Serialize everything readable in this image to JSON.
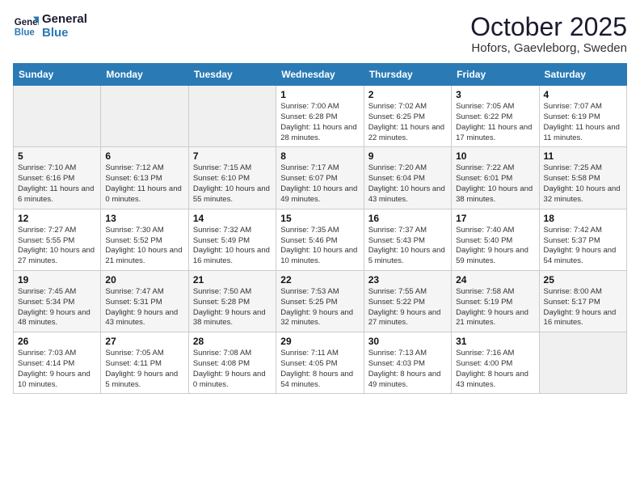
{
  "header": {
    "logo_line1": "General",
    "logo_line2": "Blue",
    "month": "October 2025",
    "location": "Hofors, Gaevleborg, Sweden"
  },
  "weekdays": [
    "Sunday",
    "Monday",
    "Tuesday",
    "Wednesday",
    "Thursday",
    "Friday",
    "Saturday"
  ],
  "weeks": [
    [
      {
        "day": "",
        "sunrise": "",
        "sunset": "",
        "daylight": ""
      },
      {
        "day": "",
        "sunrise": "",
        "sunset": "",
        "daylight": ""
      },
      {
        "day": "",
        "sunrise": "",
        "sunset": "",
        "daylight": ""
      },
      {
        "day": "1",
        "sunrise": "Sunrise: 7:00 AM",
        "sunset": "Sunset: 6:28 PM",
        "daylight": "Daylight: 11 hours and 28 minutes."
      },
      {
        "day": "2",
        "sunrise": "Sunrise: 7:02 AM",
        "sunset": "Sunset: 6:25 PM",
        "daylight": "Daylight: 11 hours and 22 minutes."
      },
      {
        "day": "3",
        "sunrise": "Sunrise: 7:05 AM",
        "sunset": "Sunset: 6:22 PM",
        "daylight": "Daylight: 11 hours and 17 minutes."
      },
      {
        "day": "4",
        "sunrise": "Sunrise: 7:07 AM",
        "sunset": "Sunset: 6:19 PM",
        "daylight": "Daylight: 11 hours and 11 minutes."
      }
    ],
    [
      {
        "day": "5",
        "sunrise": "Sunrise: 7:10 AM",
        "sunset": "Sunset: 6:16 PM",
        "daylight": "Daylight: 11 hours and 6 minutes."
      },
      {
        "day": "6",
        "sunrise": "Sunrise: 7:12 AM",
        "sunset": "Sunset: 6:13 PM",
        "daylight": "Daylight: 11 hours and 0 minutes."
      },
      {
        "day": "7",
        "sunrise": "Sunrise: 7:15 AM",
        "sunset": "Sunset: 6:10 PM",
        "daylight": "Daylight: 10 hours and 55 minutes."
      },
      {
        "day": "8",
        "sunrise": "Sunrise: 7:17 AM",
        "sunset": "Sunset: 6:07 PM",
        "daylight": "Daylight: 10 hours and 49 minutes."
      },
      {
        "day": "9",
        "sunrise": "Sunrise: 7:20 AM",
        "sunset": "Sunset: 6:04 PM",
        "daylight": "Daylight: 10 hours and 43 minutes."
      },
      {
        "day": "10",
        "sunrise": "Sunrise: 7:22 AM",
        "sunset": "Sunset: 6:01 PM",
        "daylight": "Daylight: 10 hours and 38 minutes."
      },
      {
        "day": "11",
        "sunrise": "Sunrise: 7:25 AM",
        "sunset": "Sunset: 5:58 PM",
        "daylight": "Daylight: 10 hours and 32 minutes."
      }
    ],
    [
      {
        "day": "12",
        "sunrise": "Sunrise: 7:27 AM",
        "sunset": "Sunset: 5:55 PM",
        "daylight": "Daylight: 10 hours and 27 minutes."
      },
      {
        "day": "13",
        "sunrise": "Sunrise: 7:30 AM",
        "sunset": "Sunset: 5:52 PM",
        "daylight": "Daylight: 10 hours and 21 minutes."
      },
      {
        "day": "14",
        "sunrise": "Sunrise: 7:32 AM",
        "sunset": "Sunset: 5:49 PM",
        "daylight": "Daylight: 10 hours and 16 minutes."
      },
      {
        "day": "15",
        "sunrise": "Sunrise: 7:35 AM",
        "sunset": "Sunset: 5:46 PM",
        "daylight": "Daylight: 10 hours and 10 minutes."
      },
      {
        "day": "16",
        "sunrise": "Sunrise: 7:37 AM",
        "sunset": "Sunset: 5:43 PM",
        "daylight": "Daylight: 10 hours and 5 minutes."
      },
      {
        "day": "17",
        "sunrise": "Sunrise: 7:40 AM",
        "sunset": "Sunset: 5:40 PM",
        "daylight": "Daylight: 9 hours and 59 minutes."
      },
      {
        "day": "18",
        "sunrise": "Sunrise: 7:42 AM",
        "sunset": "Sunset: 5:37 PM",
        "daylight": "Daylight: 9 hours and 54 minutes."
      }
    ],
    [
      {
        "day": "19",
        "sunrise": "Sunrise: 7:45 AM",
        "sunset": "Sunset: 5:34 PM",
        "daylight": "Daylight: 9 hours and 48 minutes."
      },
      {
        "day": "20",
        "sunrise": "Sunrise: 7:47 AM",
        "sunset": "Sunset: 5:31 PM",
        "daylight": "Daylight: 9 hours and 43 minutes."
      },
      {
        "day": "21",
        "sunrise": "Sunrise: 7:50 AM",
        "sunset": "Sunset: 5:28 PM",
        "daylight": "Daylight: 9 hours and 38 minutes."
      },
      {
        "day": "22",
        "sunrise": "Sunrise: 7:53 AM",
        "sunset": "Sunset: 5:25 PM",
        "daylight": "Daylight: 9 hours and 32 minutes."
      },
      {
        "day": "23",
        "sunrise": "Sunrise: 7:55 AM",
        "sunset": "Sunset: 5:22 PM",
        "daylight": "Daylight: 9 hours and 27 minutes."
      },
      {
        "day": "24",
        "sunrise": "Sunrise: 7:58 AM",
        "sunset": "Sunset: 5:19 PM",
        "daylight": "Daylight: 9 hours and 21 minutes."
      },
      {
        "day": "25",
        "sunrise": "Sunrise: 8:00 AM",
        "sunset": "Sunset: 5:17 PM",
        "daylight": "Daylight: 9 hours and 16 minutes."
      }
    ],
    [
      {
        "day": "26",
        "sunrise": "Sunrise: 7:03 AM",
        "sunset": "Sunset: 4:14 PM",
        "daylight": "Daylight: 9 hours and 10 minutes."
      },
      {
        "day": "27",
        "sunrise": "Sunrise: 7:05 AM",
        "sunset": "Sunset: 4:11 PM",
        "daylight": "Daylight: 9 hours and 5 minutes."
      },
      {
        "day": "28",
        "sunrise": "Sunrise: 7:08 AM",
        "sunset": "Sunset: 4:08 PM",
        "daylight": "Daylight: 9 hours and 0 minutes."
      },
      {
        "day": "29",
        "sunrise": "Sunrise: 7:11 AM",
        "sunset": "Sunset: 4:05 PM",
        "daylight": "Daylight: 8 hours and 54 minutes."
      },
      {
        "day": "30",
        "sunrise": "Sunrise: 7:13 AM",
        "sunset": "Sunset: 4:03 PM",
        "daylight": "Daylight: 8 hours and 49 minutes."
      },
      {
        "day": "31",
        "sunrise": "Sunrise: 7:16 AM",
        "sunset": "Sunset: 4:00 PM",
        "daylight": "Daylight: 8 hours and 43 minutes."
      },
      {
        "day": "",
        "sunrise": "",
        "sunset": "",
        "daylight": ""
      }
    ]
  ]
}
